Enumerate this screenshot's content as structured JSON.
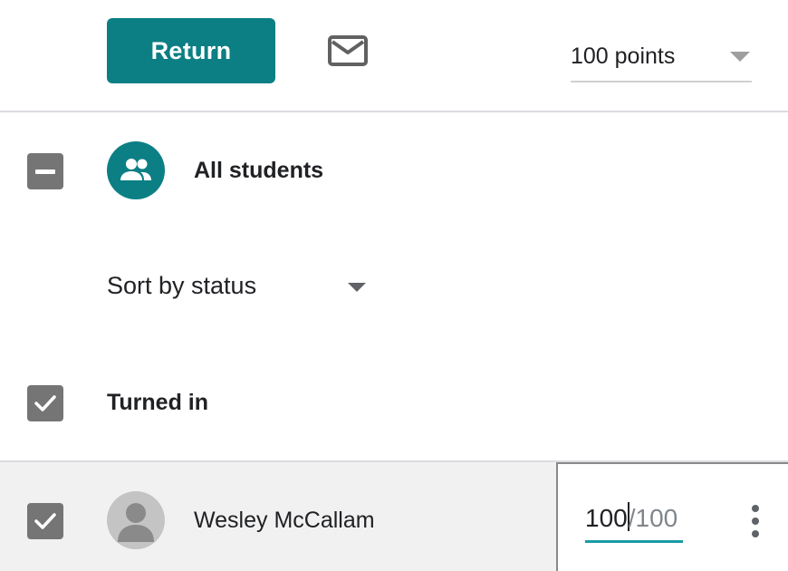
{
  "toolbar": {
    "return_label": "Return",
    "mail_icon": "mail-icon",
    "points_value": "100 points"
  },
  "students_header": {
    "label": "All students",
    "select_state": "indeterminate",
    "avatar_icon": "group-icon"
  },
  "sort": {
    "label": "Sort by status"
  },
  "section": {
    "label": "Turned in",
    "checked": true
  },
  "student": {
    "name": "Wesley McCallam",
    "checked": true,
    "grade": "100",
    "grade_denominator": "/100"
  },
  "colors": {
    "accent": "#0b7f84",
    "grade_underline": "#1a9ba6",
    "checkbox": "#757575"
  }
}
